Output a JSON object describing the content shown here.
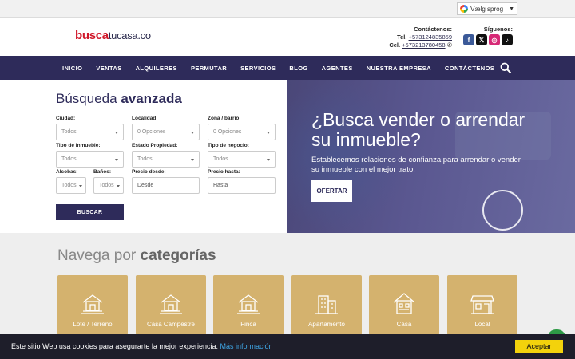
{
  "topbar": {
    "language_label": "Vælg sprog",
    "language_arrow": "▼"
  },
  "header": {
    "logo_part1": "busca",
    "logo_part2": "tucasa.co",
    "contact_title": "Contáctenos:",
    "tel_label": "Tel.",
    "tel_number": "+573124835859",
    "cel_label": "Cel.",
    "cel_number": "+573213780458",
    "follow_title": "Síguenos:",
    "social": [
      {
        "name": "facebook-icon",
        "glyph": "f",
        "color": "#3b5998"
      },
      {
        "name": "x-icon",
        "glyph": "𝕏",
        "color": "#111111"
      },
      {
        "name": "instagram-icon",
        "glyph": "◎",
        "color": "#d62976"
      },
      {
        "name": "tiktok-icon",
        "glyph": "♪",
        "color": "#111111"
      }
    ]
  },
  "nav": {
    "items": [
      "INICIO",
      "VENTAS",
      "ALQUILERES",
      "PERMUTAR",
      "SERVICIOS",
      "BLOG",
      "AGENTES",
      "NUESTRA EMPRESA",
      "CONTÁCTENOS"
    ]
  },
  "search": {
    "title_light": "Búsqueda",
    "title_bold": "avanzada",
    "fields": {
      "ciudad": {
        "label": "Ciudad:",
        "value": "Todos"
      },
      "localidad": {
        "label": "Localidad:",
        "value": "0 Opciones"
      },
      "zona": {
        "label": "Zona / barrio:",
        "value": "0 Opciones"
      },
      "tipo_inmueble": {
        "label": "Tipo de inmueble:",
        "value": "Todos"
      },
      "estado": {
        "label": "Estado Propiedad:",
        "value": "Todos"
      },
      "tipo_negocio": {
        "label": "Tipo de negocio:",
        "value": "Todos"
      },
      "alcobas": {
        "label": "Alcobas:",
        "value": "Todos"
      },
      "banos": {
        "label": "Baños:",
        "value": "Todos"
      },
      "precio_desde": {
        "label": "Precio desde:",
        "placeholder": "Desde"
      },
      "precio_hasta": {
        "label": "Precio hasta:",
        "placeholder": "Hasta"
      }
    },
    "button": "BUSCAR"
  },
  "hero": {
    "heading": "¿Busca vender o arrendar su inmueble?",
    "text": "Establecemos relaciones de confianza para arrendar o vender su inmueble con el mejor trato.",
    "button": "OFERTAR"
  },
  "categories": {
    "title_light": "Navega por",
    "title_bold": "categorías",
    "items": [
      "Lote / Terreno",
      "Casa Campestre",
      "Finca",
      "Apartamento",
      "Casa",
      "Local"
    ]
  },
  "cookie": {
    "message": "Este sitio Web usa cookies para asegurarte la mejor experiencia.",
    "more": "Más información",
    "accept": "Aceptar"
  },
  "colors": {
    "brand_red": "#d0182a",
    "brand_navy": "#2e2b5a",
    "category_gold": "#d4b26e",
    "cookie_accept": "#f3d20c"
  }
}
